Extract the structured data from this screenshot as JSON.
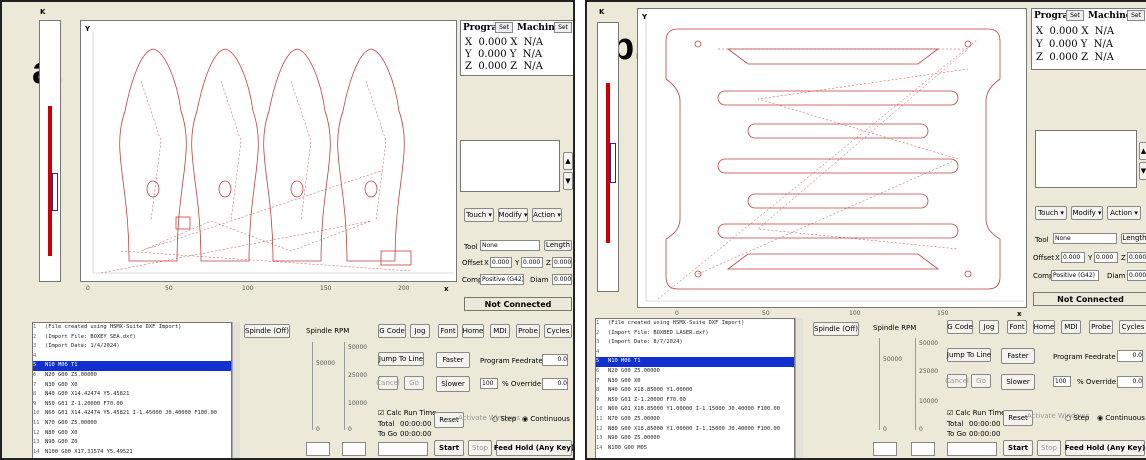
{
  "common": {
    "axis_x_ticks": [
      "0",
      "50",
      "100",
      "150",
      "200"
    ],
    "view_corner_x": "x",
    "axis_k": "K",
    "axis_y": "Y",
    "dro": {
      "program_tab": "Program",
      "program_sel": "Set",
      "machine_tab": "Machine",
      "machine_sel": "Set",
      "rows": [
        {
          "axis": "X",
          "program": "0.000",
          "machine": "N/A"
        },
        {
          "axis": "Y",
          "program": "0.000",
          "machine": "N/A"
        },
        {
          "axis": "Z",
          "program": "0.000",
          "machine": "N/A"
        }
      ]
    },
    "menus": {
      "touch": "Touch",
      "modify": "Modify",
      "action": "Action"
    },
    "tool_label": "Tool",
    "tool_value": "None",
    "length_label": "Length",
    "offset_label": "Offset",
    "offset_x_label": "X",
    "offset_x": "0.000",
    "offset_y_label": "Y",
    "offset_y": "0.000",
    "offset_z_label": "Z",
    "offset_z": "0.000",
    "comp_label": "Comp",
    "comp_value": "Positive (G42)",
    "diam_label": "Diam",
    "diam_value": "0.000",
    "status": "Not Connected",
    "tabs": [
      "G Code",
      "Jog",
      "Font",
      "Home",
      "MDI",
      "Probe",
      "Cycles"
    ],
    "spindle_off": "Spindle (Off)",
    "spindle_rpm": "Spindle RPM",
    "rpm_marks": [
      "50000",
      "25000",
      "10000"
    ],
    "slider_zero": "0",
    "jump_to_line": "Jump To Line",
    "cancel": "Cancel",
    "go": "Go",
    "faster": "Faster",
    "slower": "Slower",
    "program_feedrate": "Program Feedrate",
    "feedrate_value": "0.0",
    "override_value": "100",
    "override_label": "% Override",
    "override_field": "0.0",
    "calc_run_time": "Calc Run Time",
    "total_label": "Total",
    "total_value": "00:00:00",
    "togo_label": "To Go",
    "togo_value": "00:00:00",
    "reset": "Reset",
    "step": "Step",
    "continuous": "Continuous",
    "start": "Start",
    "stop": "Stop",
    "feed_hold": "Feed Hold (Any Key)",
    "watermark": "Activate Windows"
  },
  "panel_a": {
    "tag": "a.",
    "code_lines": [
      "(File created using HSMX-Suite DXF Import)",
      "(Import File: BOXEY SEA.dxf)",
      "(Import Date: 1/4/2024)",
      "",
      "N10 M06 T1",
      "N20 G00 Z5.00000",
      "N30 G00 X0",
      "N40 G00 X14.42474 Y5.45821",
      "N50 G01 Z-1.20000 F70.00",
      "N60 G01 X14.42474 Y5.45821 I-1.45000 J0.40000 F100.00",
      "N70 G00 Z5.00000",
      "N80 G00 X0",
      "N90 G00 Z0",
      "N100 G00 X17.31574 Y5.49521"
    ],
    "highlight_line": 4
  },
  "panel_b": {
    "tag": "b.",
    "code_lines": [
      "(File created using HSMX-Suite DXF Import)",
      "(Import File: BOXBED LASER.dxf)",
      "(Import Date: 8/7/2024)",
      "",
      "N10 M06 T1",
      "N20 G00 Z5.00000",
      "N30 G00 X0",
      "N40 G00 X18.85000 Y1.00000",
      "N50 G01 Z-1.20000 F70.00",
      "N60 G01 X18.85000 Y1.00000 I-1.15000 J0.40000 F100.00",
      "N70 G00 Z5.00000",
      "N80 G00 X18.85000 Y1.00000 I-1.15000 J0.40000 F100.00",
      "N90 G00 Z5.00000",
      "N100 G00 M05"
    ],
    "highlight_line": 4
  },
  "colors": {
    "path": "#c04040",
    "highlight": "#1030d0",
    "zbar": "#cc0000"
  }
}
